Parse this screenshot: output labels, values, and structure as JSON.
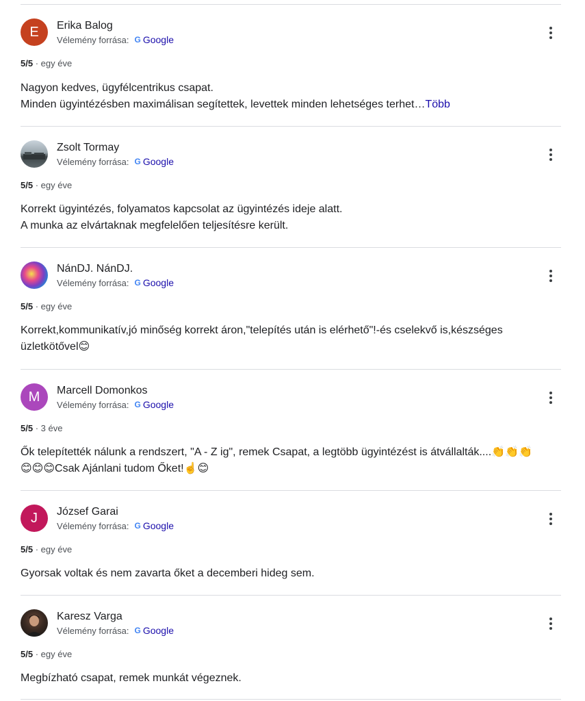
{
  "source_label": "Vélemény forrása:",
  "source_name": "Google",
  "google_g": "G",
  "separator": "·",
  "reviews": [
    {
      "initial": "E",
      "avatar_color": "#c5411f",
      "author": "Erika Balog",
      "rating": "5/5",
      "age": "egy éve",
      "line1": "Nagyon kedves, ügyfélcentrikus csapat.",
      "line2": "Minden ügyintézésben maximálisan segítettek, levettek minden lehetséges terhet…",
      "more": "Több"
    },
    {
      "initial": "",
      "avatar_color": "#7f8c94",
      "author": "Zsolt Tormay",
      "rating": "5/5",
      "age": "egy éve",
      "line1": "Korrekt ügyintézés, folyamatos kapcsolat az ügyintézés ideje alatt.",
      "line2": "A munka az elvártaknak megfelelően teljesítésre került."
    },
    {
      "initial": "",
      "avatar_color": "#c84fa0",
      "author": "NánDJ. NánDJ.",
      "rating": "5/5",
      "age": "egy éve",
      "line1": "Korrekt,kommunikatív,jó minőség korrekt áron,\"telepítés után is elérhető\"!-és cselekvő is,készséges",
      "line2": "üzletkötővel😊"
    },
    {
      "initial": "M",
      "avatar_color": "#ab47bc",
      "author": "Marcell Domonkos",
      "rating": "5/5",
      "age": "3 éve",
      "line1": "Ők telepítették nálunk a rendszert, \"A - Z ig\", remek Csapat, a legtöbb ügyintézést is átvállalták....👏👏👏",
      "line2": "😊😊😊Csak Ajánlani tudom Őket!☝️😊"
    },
    {
      "initial": "J",
      "avatar_color": "#c2185b",
      "author": "József Garai",
      "rating": "5/5",
      "age": "egy éve",
      "line1": "Gyorsak voltak és nem zavarta őket a decemberi hideg sem."
    },
    {
      "initial": "",
      "avatar_color": "#2b2420",
      "author": "Karesz Varga",
      "rating": "5/5",
      "age": "egy éve",
      "line1": "Megbízható csapat, remek munkát végeznek."
    }
  ]
}
